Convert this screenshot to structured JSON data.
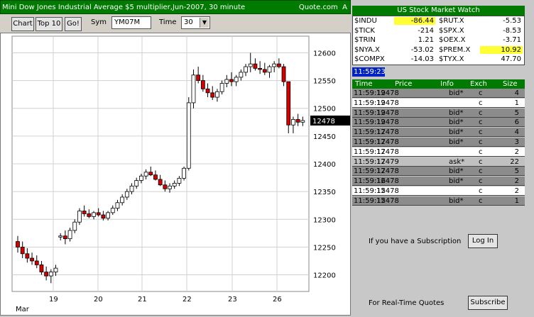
{
  "title_bar": {
    "text": "Mini Dow Jones Industrial Average $5 multiplier,Jun-2007, 30 minute",
    "source": "Quote.com",
    "close_glyph": "A"
  },
  "toolbar": {
    "chart_label": "Chart",
    "top10_label": "Top 10",
    "go_label": "Go!",
    "sym_label": "Sym",
    "sym_value": "YM07M",
    "time_label": "Time",
    "time_value": "30"
  },
  "chart_data": {
    "type": "candlestick",
    "current_price": "12478",
    "y_ticks": [
      "12600",
      "12550",
      "12500",
      "12450",
      "12400",
      "12350",
      "12300",
      "12250",
      "12200"
    ],
    "x_ticks": [
      "19",
      "20",
      "21",
      "22",
      "23",
      "26"
    ],
    "x_month": "Mar",
    "ylim": [
      12170,
      12630
    ],
    "candles": [
      [
        12260,
        12270,
        12240,
        12250
      ],
      [
        12250,
        12260,
        12230,
        12238
      ],
      [
        12238,
        12248,
        12222,
        12230
      ],
      [
        12230,
        12240,
        12218,
        12225
      ],
      [
        12225,
        12235,
        12212,
        12218
      ],
      [
        12218,
        12225,
        12200,
        12205
      ],
      [
        12205,
        12215,
        12190,
        12198
      ],
      [
        12198,
        12210,
        12185,
        12205
      ],
      [
        12205,
        12218,
        12198,
        12212
      ],
      [
        12268,
        12275,
        12262,
        12270
      ],
      [
        12270,
        12280,
        12255,
        12265
      ],
      [
        12265,
        12285,
        12260,
        12280
      ],
      [
        12280,
        12300,
        12275,
        12295
      ],
      [
        12295,
        12320,
        12290,
        12315
      ],
      [
        12315,
        12325,
        12305,
        12310
      ],
      [
        12310,
        12318,
        12302,
        12305
      ],
      [
        12305,
        12315,
        12300,
        12312
      ],
      [
        12312,
        12320,
        12305,
        12308
      ],
      [
        12308,
        12315,
        12298,
        12302
      ],
      [
        12302,
        12315,
        12298,
        12312
      ],
      [
        12312,
        12325,
        12308,
        12320
      ],
      [
        12320,
        12335,
        12315,
        12330
      ],
      [
        12330,
        12345,
        12325,
        12340
      ],
      [
        12340,
        12355,
        12335,
        12350
      ],
      [
        12350,
        12365,
        12345,
        12360
      ],
      [
        12360,
        12375,
        12355,
        12370
      ],
      [
        12370,
        12382,
        12365,
        12378
      ],
      [
        12378,
        12390,
        12372,
        12385
      ],
      [
        12385,
        12395,
        12378,
        12380
      ],
      [
        12380,
        12388,
        12370,
        12372
      ],
      [
        12372,
        12380,
        12360,
        12362
      ],
      [
        12362,
        12370,
        12350,
        12355
      ],
      [
        12355,
        12365,
        12348,
        12360
      ],
      [
        12360,
        12370,
        12355,
        12365
      ],
      [
        12365,
        12378,
        12360,
        12374
      ],
      [
        12374,
        12395,
        12370,
        12392
      ],
      [
        12392,
        12520,
        12388,
        12510
      ],
      [
        12510,
        12570,
        12500,
        12560
      ],
      [
        12560,
        12575,
        12545,
        12550
      ],
      [
        12550,
        12560,
        12530,
        12535
      ],
      [
        12535,
        12545,
        12520,
        12528
      ],
      [
        12528,
        12540,
        12515,
        12520
      ],
      [
        12520,
        12535,
        12512,
        12530
      ],
      [
        12530,
        12550,
        12525,
        12545
      ],
      [
        12545,
        12560,
        12538,
        12552
      ],
      [
        12552,
        12565,
        12540,
        12548
      ],
      [
        12548,
        12560,
        12540,
        12556
      ],
      [
        12556,
        12570,
        12550,
        12565
      ],
      [
        12565,
        12580,
        12558,
        12575
      ],
      [
        12575,
        12600,
        12565,
        12580
      ],
      [
        12580,
        12590,
        12568,
        12572
      ],
      [
        12572,
        12585,
        12562,
        12570
      ],
      [
        12570,
        12582,
        12560,
        12565
      ],
      [
        12565,
        12578,
        12555,
        12575
      ],
      [
        12575,
        12585,
        12565,
        12580
      ],
      [
        12580,
        12590,
        12572,
        12575
      ],
      [
        12575,
        12580,
        12540,
        12548
      ],
      [
        12548,
        12500,
        12455,
        12470
      ],
      [
        12470,
        12485,
        12455,
        12480
      ],
      [
        12480,
        12490,
        12468,
        12475
      ],
      [
        12475,
        12485,
        12468,
        12478
      ]
    ]
  },
  "watch": {
    "title": "US Stock Market Watch",
    "rows": [
      {
        "sym1": "$INDU",
        "val1": "-86.44",
        "sym2": "$RUT.X",
        "val2": "-5.53"
      },
      {
        "sym1": "$TICK",
        "val1": "-214",
        "sym2": "$SPX.X",
        "val2": "-8.53"
      },
      {
        "sym1": "$TRIN",
        "val1": "1.21",
        "sym2": "$OEX.X",
        "val2": "-3.71"
      },
      {
        "sym1": "$NYA.X",
        "val1": "-53.02",
        "sym2": "$PREM.X",
        "val2": "10.92"
      },
      {
        "sym1": "$COMPX",
        "val1": "-14.03",
        "sym2": "$TYX.X",
        "val2": "47.70"
      }
    ]
  },
  "clock": "11:59:23",
  "trades": {
    "headers": [
      "Time",
      "Price",
      "Info",
      "Exch",
      "Size"
    ],
    "rows": [
      [
        "11:59:19",
        "12478",
        "bid*",
        "c",
        "4"
      ],
      [
        "11:59:19",
        "12478",
        "",
        "c",
        "1"
      ],
      [
        "11:59:19",
        "12478",
        "bid*",
        "c",
        "5"
      ],
      [
        "11:59:19",
        "12478",
        "bid*",
        "c",
        "6"
      ],
      [
        "11:59:17",
        "12478",
        "bid*",
        "c",
        "4"
      ],
      [
        "11:59:17",
        "12478",
        "bid*",
        "c",
        "3"
      ],
      [
        "11:59:17",
        "12478",
        "",
        "c",
        "2"
      ],
      [
        "11:59:17",
        "12479",
        "ask*",
        "c",
        "22"
      ],
      [
        "11:59:17",
        "12478",
        "bid*",
        "c",
        "5"
      ],
      [
        "11:59:16",
        "12478",
        "bid*",
        "c",
        "2"
      ],
      [
        "11:59:15",
        "12478",
        "",
        "c",
        "2"
      ],
      [
        "11:59:15",
        "12478",
        "bid*",
        "c",
        "1"
      ]
    ]
  },
  "subscription": {
    "text": "If you have a Subscription",
    "login_label": "Log In",
    "realtime_text": "For Real-Time Quotes",
    "subscribe_label": "Subscribe"
  }
}
